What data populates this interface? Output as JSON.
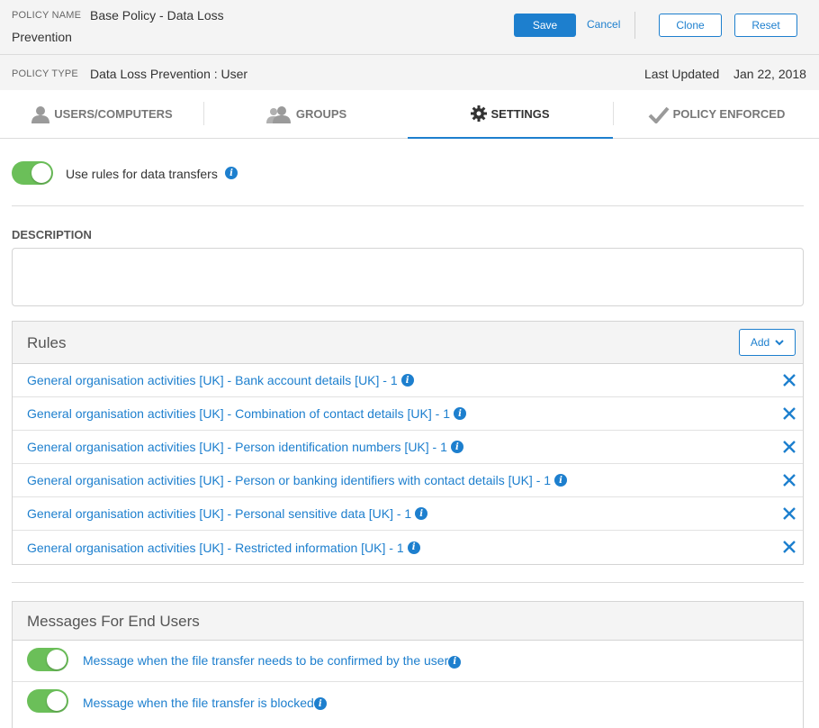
{
  "header": {
    "policy_name_label": "POLICY NAME",
    "policy_name_line1": "Base Policy - Data Loss",
    "policy_name_line2": "Prevention",
    "save_label": "Save",
    "cancel_label": "Cancel",
    "clone_label": "Clone",
    "reset_label": "Reset",
    "policy_type_label": "POLICY TYPE",
    "policy_type_value": "Data Loss Prevention : User",
    "last_updated_label": "Last Updated",
    "last_updated_value": "Jan 22, 2018"
  },
  "tabs": [
    {
      "label": "USERS/COMPUTERS",
      "icon": "user-icon"
    },
    {
      "label": "GROUPS",
      "icon": "users-icon"
    },
    {
      "label": "SETTINGS",
      "icon": "gear-icon",
      "active": true
    },
    {
      "label": "POLICY ENFORCED",
      "icon": "checkmark-icon"
    }
  ],
  "settings": {
    "toggle_label": "Use rules for data transfers",
    "toggle_on": true,
    "description_label": "DESCRIPTION",
    "description_value": ""
  },
  "rules": {
    "title": "Rules",
    "add_label": "Add",
    "items": [
      "General organisation activities [UK] - Bank account details [UK] - 1",
      "General organisation activities [UK] - Combination of contact details [UK] - 1",
      "General organisation activities [UK] - Person identification numbers [UK] - 1",
      "General organisation activities [UK] - Person or banking identifiers with contact details [UK] - 1",
      "General organisation activities [UK] - Personal sensitive data [UK] - 1",
      "General organisation activities [UK] - Restricted information [UK] - 1"
    ]
  },
  "messages": {
    "title": "Messages For End Users",
    "items": [
      {
        "label": "Message when the file transfer needs to be confirmed by the user",
        "on": true
      },
      {
        "label": "Message when the file transfer is blocked",
        "on": true
      }
    ]
  },
  "colors": {
    "accent": "#1d7fce",
    "toggle_on": "#6bbf59"
  }
}
